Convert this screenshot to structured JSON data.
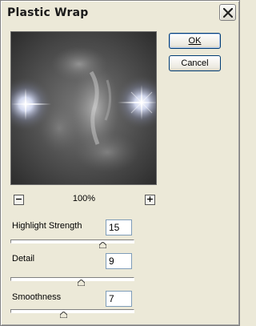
{
  "window": {
    "title": "Plastic Wrap"
  },
  "preview": {
    "zoom_level": "100%"
  },
  "buttons": {
    "ok_label": "OK",
    "cancel_label": "Cancel"
  },
  "zoom": {
    "minus_label": "−",
    "plus_label": "+"
  },
  "params": [
    {
      "label": "Highlight Strength",
      "value": "15",
      "min": 0,
      "max": 20
    },
    {
      "label": "Detail",
      "value": "9",
      "min": 1,
      "max": 15
    },
    {
      "label": "Smoothness",
      "value": "7",
      "min": 1,
      "max": 15
    }
  ],
  "icons": {
    "close": "close-icon"
  }
}
